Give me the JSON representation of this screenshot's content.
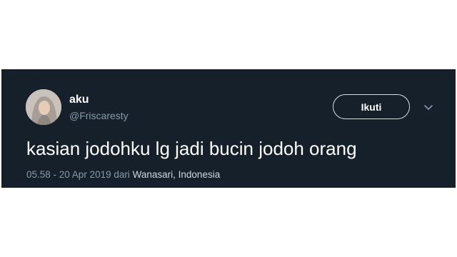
{
  "tweet": {
    "display_name": "aku",
    "handle": "@Friscaresty",
    "follow_label": "Ikuti",
    "text": "kasian jodohku lg jadi bucin jodoh orang",
    "timestamp": "05.58 - 20 Apr 2019",
    "location_prefix": "dari",
    "location": "Wanasari, Indonesia"
  },
  "colors": {
    "background": "#15202b",
    "text_primary": "#ffffff",
    "text_secondary": "#8899a6"
  },
  "icons": {
    "caret": "chevron-down-icon"
  }
}
